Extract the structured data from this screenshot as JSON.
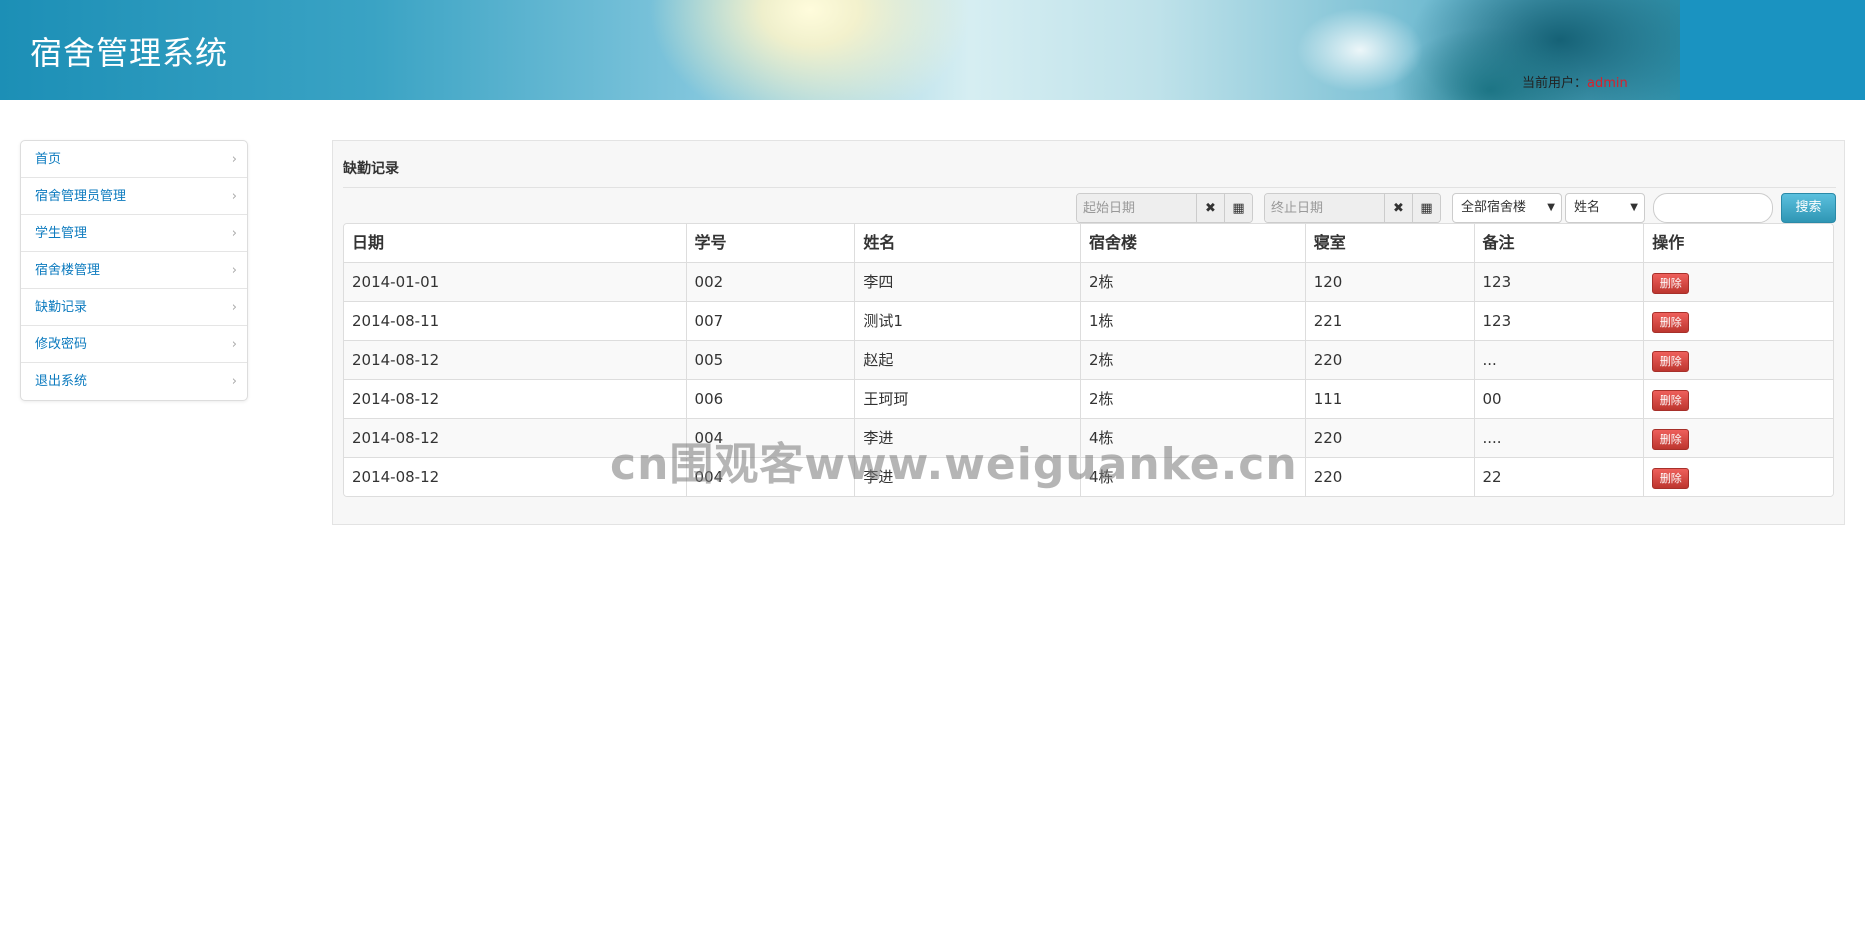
{
  "header": {
    "title": "宿舍管理系统",
    "current_user_label": "当前用户：",
    "current_user_name": "admin",
    "user_name_color": "#d9202c"
  },
  "sidebar": {
    "items": [
      {
        "label": "首页"
      },
      {
        "label": "宿舍管理员管理"
      },
      {
        "label": "学生管理"
      },
      {
        "label": "宿舍楼管理"
      },
      {
        "label": "缺勤记录"
      },
      {
        "label": "修改密码"
      },
      {
        "label": "退出系统"
      }
    ],
    "chevron": "›"
  },
  "panel": {
    "title": "缺勤记录"
  },
  "toolbar": {
    "start_date_placeholder": "起始日期",
    "end_date_placeholder": "终止日期",
    "clear_icon": "✖",
    "calendar_icon": "▦",
    "building_select": "全部宿舍楼",
    "field_select": "姓名",
    "search_value": "",
    "search_button": "搜索"
  },
  "table": {
    "headers": [
      "日期",
      "学号",
      "姓名",
      "宿舍楼",
      "寝室",
      "备注",
      "操作"
    ],
    "rows": [
      {
        "date": "2014-01-01",
        "student_no": "002",
        "name": "李四",
        "building": "2栋",
        "room": "120",
        "note": "123",
        "action": "删除"
      },
      {
        "date": "2014-08-11",
        "student_no": "007",
        "name": "测试1",
        "building": "1栋",
        "room": "221",
        "note": "123",
        "action": "删除"
      },
      {
        "date": "2014-08-12",
        "student_no": "005",
        "name": "赵起",
        "building": "2栋",
        "room": "220",
        "note": "...",
        "action": "删除"
      },
      {
        "date": "2014-08-12",
        "student_no": "006",
        "name": "王珂珂",
        "building": "2栋",
        "room": "111",
        "note": "00",
        "action": "删除"
      },
      {
        "date": "2014-08-12",
        "student_no": "004",
        "name": "李进",
        "building": "4栋",
        "room": "220",
        "note": "....",
        "action": "删除"
      },
      {
        "date": "2014-08-12",
        "student_no": "004",
        "name": "李进",
        "building": "4栋",
        "room": "220",
        "note": "22",
        "action": "删除"
      }
    ]
  },
  "watermark": "cn围观客www.weiguanke.cn",
  "colors": {
    "link": "#0d7bbf",
    "search_button": "#2f96b4",
    "delete_button": "#bd362f"
  }
}
